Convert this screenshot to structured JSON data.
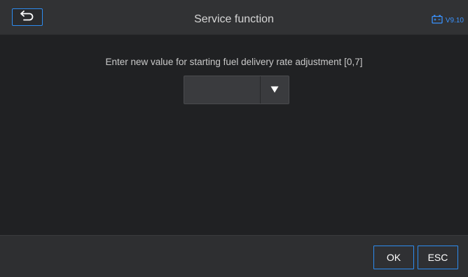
{
  "header": {
    "title": "Service function",
    "version": "V9.10",
    "back_icon": "return-arrow-icon",
    "battery_icon": "battery-icon"
  },
  "main": {
    "prompt": "Enter new value for starting fuel delivery rate adjustment [0,7]",
    "select": {
      "value": "",
      "arrow_icon": "triangle-down-icon"
    }
  },
  "footer": {
    "ok_label": "OK",
    "esc_label": "ESC"
  },
  "colors": {
    "accent": "#2d8cf0",
    "header_bg": "#313234",
    "content_bg": "#202123",
    "footer_bg": "#2e2f31"
  }
}
